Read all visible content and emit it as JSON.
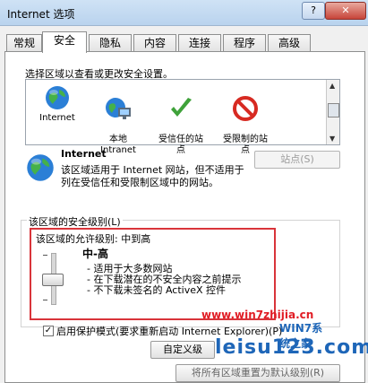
{
  "window": {
    "title": "Internet 选项",
    "help_label": "?",
    "close_label": "✕"
  },
  "tabs": [
    "常规",
    "安全",
    "隐私",
    "内容",
    "连接",
    "程序",
    "高级"
  ],
  "select_zone_label": "选择区域以查看或更改安全设置。",
  "zones": [
    {
      "label": "Internet",
      "icon": "globe-icon"
    },
    {
      "label": "本地\nIntranet",
      "icon": "local-intranet-icon"
    },
    {
      "label": "受信任的站\n点",
      "icon": "check-icon"
    },
    {
      "label": "受限制的站\n点",
      "icon": "restricted-icon"
    }
  ],
  "zone_info": {
    "name": "Internet",
    "description": "该区域适用于 Internet 网站，但不适用于列在受信任和受限制区域中的网站。",
    "sites_button": "站点(S)"
  },
  "security_level": {
    "group_label": "该区域的安全级别(L)",
    "allowed_levels": "该区域的允许级别: 中到高",
    "level_name": "中-高",
    "bullets": [
      "- 适用于大多数网站",
      "- 在下载潜在的不安全内容之前提示",
      "- 不下载未签名的 ActiveX 控件"
    ],
    "slider_level": "中-高"
  },
  "protected_mode": {
    "label": "启用保护模式(要求重新启动 Internet Explorer)(P)",
    "checked": true
  },
  "buttons": {
    "custom_level": "自定义级",
    "reset_all": "将所有区域重置为默认级别(R)"
  },
  "watermarks": {
    "url": "www.win7zhijia.cn",
    "logo": "WIN7系统之家",
    "site": "leisu123.com"
  },
  "colors": {
    "highlight_border": "#d9343a",
    "watermark_red": "#e11d25",
    "watermark_blue": "#1e66b8"
  }
}
